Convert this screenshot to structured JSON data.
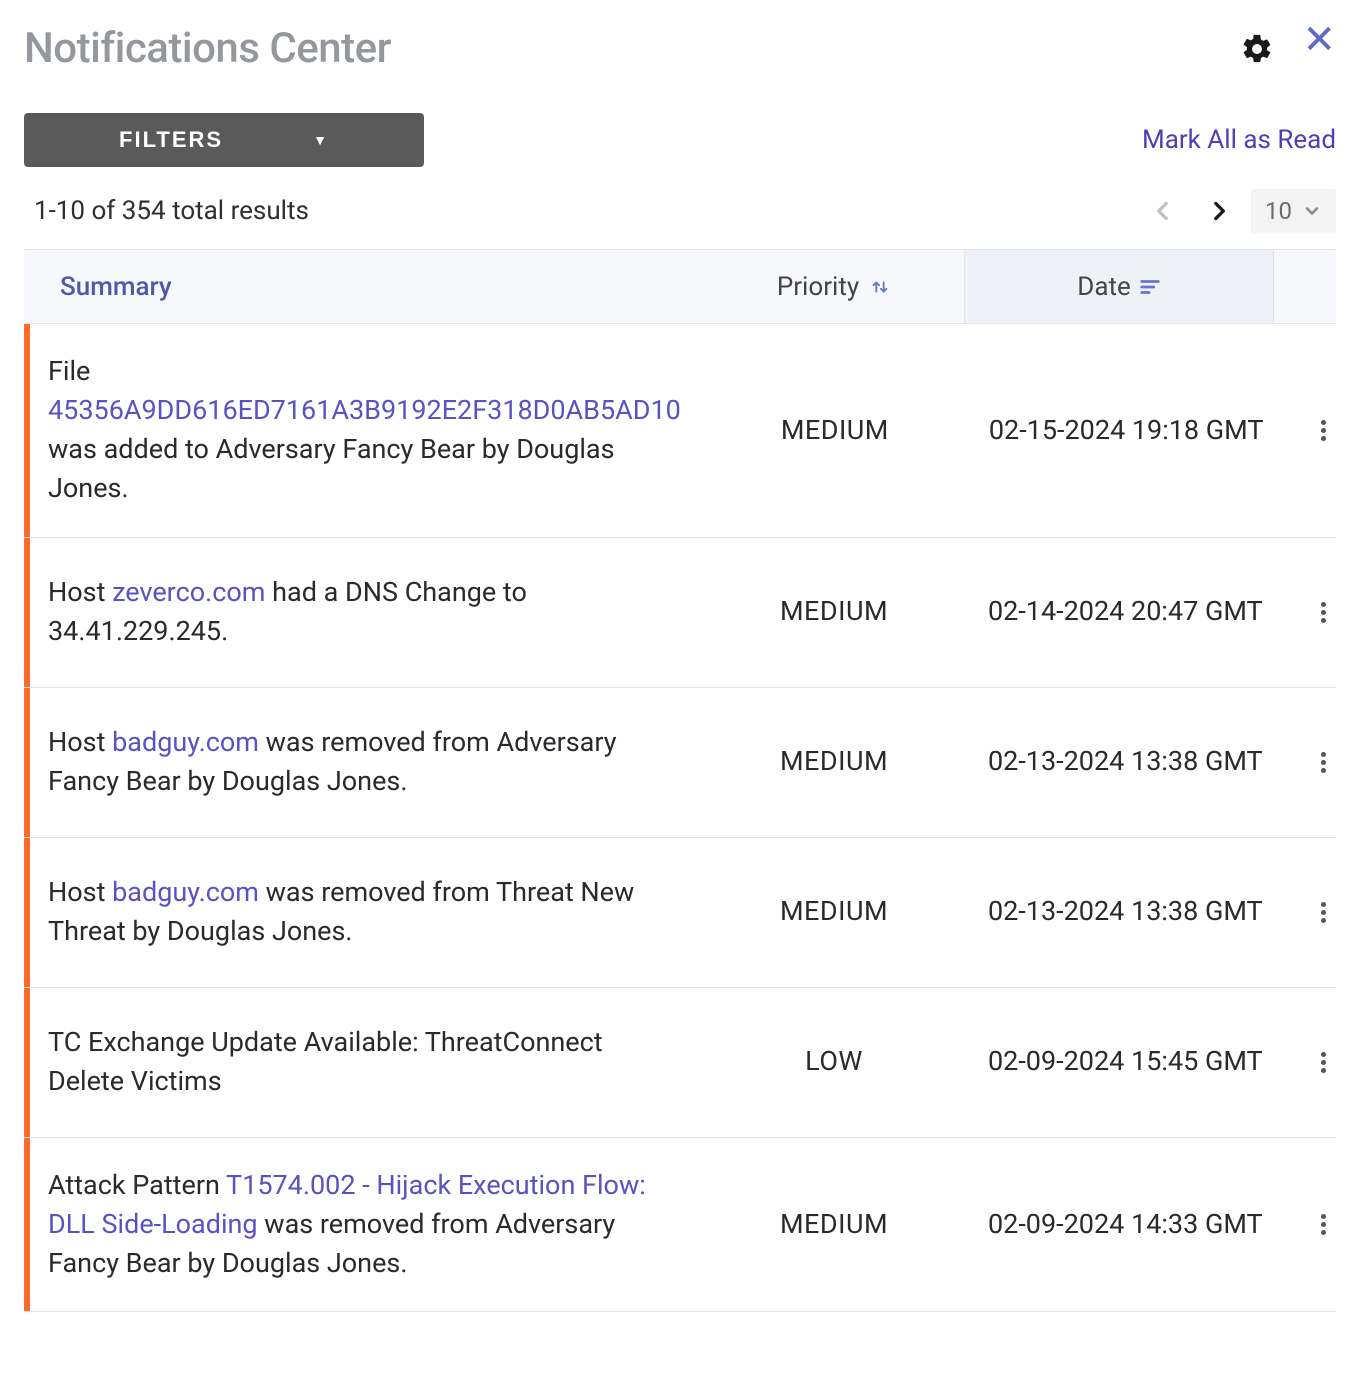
{
  "header": {
    "title": "Notifications Center"
  },
  "toolbar": {
    "filters_label": "FILTERS",
    "mark_all_label": "Mark All as Read"
  },
  "pagination": {
    "results_text": "1-10 of 354 total results",
    "page_size": "10"
  },
  "columns": {
    "summary": "Summary",
    "priority": "Priority",
    "date": "Date"
  },
  "rows": [
    {
      "summary_parts": [
        {
          "t": "File ",
          "link": false
        },
        {
          "t": "45356A9DD616ED7161A3B9192E2F318D0AB5AD10",
          "link": true
        },
        {
          "t": " was added to Adversary Fancy Bear by Douglas Jones.",
          "link": false
        }
      ],
      "priority": "MEDIUM",
      "date": "02-15-2024 19:18 GMT"
    },
    {
      "summary_parts": [
        {
          "t": "Host ",
          "link": false
        },
        {
          "t": "zeverco.com",
          "link": true
        },
        {
          "t": " had a DNS Change to 34.41.229.245.",
          "link": false
        }
      ],
      "priority": "MEDIUM",
      "date": "02-14-2024 20:47 GMT"
    },
    {
      "summary_parts": [
        {
          "t": "Host ",
          "link": false
        },
        {
          "t": "badguy.com",
          "link": true
        },
        {
          "t": " was removed from Adversary Fancy Bear by Douglas Jones.",
          "link": false
        }
      ],
      "priority": "MEDIUM",
      "date": "02-13-2024 13:38 GMT"
    },
    {
      "summary_parts": [
        {
          "t": "Host ",
          "link": false
        },
        {
          "t": "badguy.com",
          "link": true
        },
        {
          "t": " was removed from Threat New Threat by Douglas Jones.",
          "link": false
        }
      ],
      "priority": "MEDIUM",
      "date": "02-13-2024 13:38 GMT"
    },
    {
      "summary_parts": [
        {
          "t": "TC Exchange Update Available: ThreatConnect Delete Victims",
          "link": false
        }
      ],
      "priority": "LOW",
      "date": "02-09-2024 15:45 GMT"
    },
    {
      "summary_parts": [
        {
          "t": "Attack Pattern ",
          "link": false
        },
        {
          "t": "T1574.002 - Hijack Execution Flow: DLL Side-Loading",
          "link": true
        },
        {
          "t": " was removed from Adversary Fancy Bear by Douglas Jones.",
          "link": false
        }
      ],
      "priority": "MEDIUM",
      "date": "02-09-2024 14:33 GMT"
    }
  ]
}
